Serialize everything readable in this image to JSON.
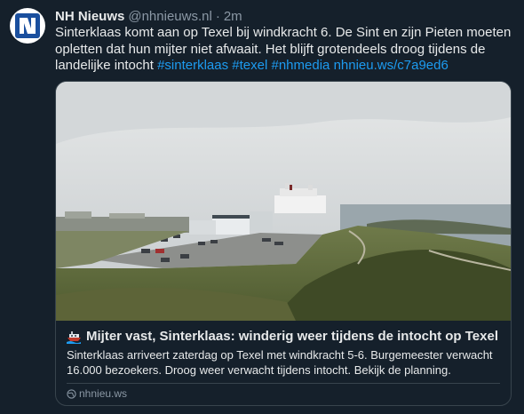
{
  "account": {
    "name": "NH Nieuws",
    "handle": "@nhnieuws.nl",
    "separator": "·",
    "time": "2m",
    "avatar_icon": "nh-logo-icon",
    "avatar_color": "#1a4f9e"
  },
  "tweet": {
    "text": "Sinterklaas komt aan op Texel bij windkracht 6. De Sint en zijn Pieten moeten opletten dat hun mijter niet afwaait. Het blijft grotendeels droog tijdens de landelijke intocht",
    "hashtags": [
      "#sinterklaas",
      "#texel",
      "#nhmedia"
    ],
    "link": "nhnieu.ws/c7a9ed6",
    "link_color": "#1d9bf0"
  },
  "card": {
    "image_alt": "Harbour of Texel with ferry under a grey sky",
    "title_icon": "ship-icon",
    "title": "Mijter vast, Sinterklaas: winderig weer tijdens de intocht op Texel",
    "description": "Sinterklaas arriveert zaterdag op Texel met windkracht 5-6. Burgemeester verwacht 16.000 bezoekers. Droog weer verwacht tijdens intocht. Bekijk de planning.",
    "domain_icon": "globe-icon",
    "domain": "nhnieu.ws"
  }
}
